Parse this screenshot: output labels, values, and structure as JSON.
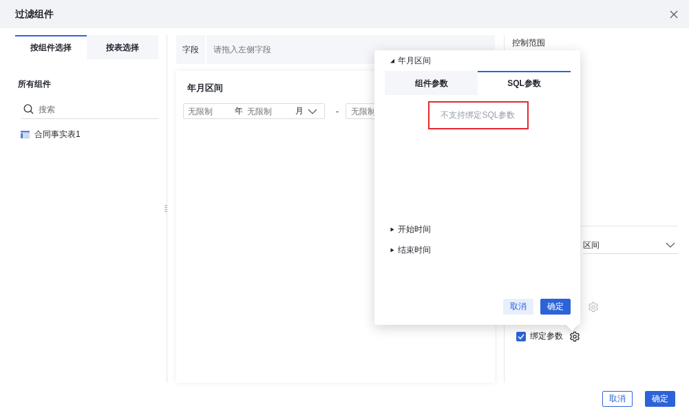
{
  "window": {
    "title": "过滤组件"
  },
  "left_tabs": [
    {
      "label": "按组件选择",
      "selected": true
    },
    {
      "label": "按表选择",
      "selected": false
    }
  ],
  "components": {
    "heading": "所有组件",
    "search": {
      "placeholder": "搜索"
    },
    "items": [
      {
        "label": "合同事实表1"
      }
    ]
  },
  "field_bar": {
    "label": "字段",
    "placeholder": "请拖入左侧字段"
  },
  "preview": {
    "title": "年月区间",
    "start": {
      "year_placeholder": "无限制",
      "year_unit": "年",
      "month_placeholder": "无限制",
      "month_unit": "月"
    },
    "separator": "-",
    "end": {
      "year_placeholder": "无限制"
    }
  },
  "settings": {
    "heading": "控制范围",
    "dropdown_value": "区间",
    "gear_disabled": true,
    "bind_params": {
      "label": "绑定参数",
      "checked": true
    }
  },
  "popup": {
    "title": "年月区间",
    "expanded": true,
    "tabs": [
      {
        "label": "组件参数",
        "selected": false
      },
      {
        "label": "SQL参数",
        "selected": true
      }
    ],
    "message": "不支持绑定SQL参数",
    "params": [
      {
        "label": "开始时间",
        "expanded": false
      },
      {
        "label": "结束时间",
        "expanded": false
      }
    ],
    "buttons": [
      {
        "label": "取消",
        "kind": "secondary"
      },
      {
        "label": "确定",
        "kind": "primary"
      }
    ]
  },
  "footer_buttons": [
    {
      "label": "取消",
      "kind": "outline"
    },
    {
      "label": "确定",
      "kind": "primary"
    }
  ]
}
